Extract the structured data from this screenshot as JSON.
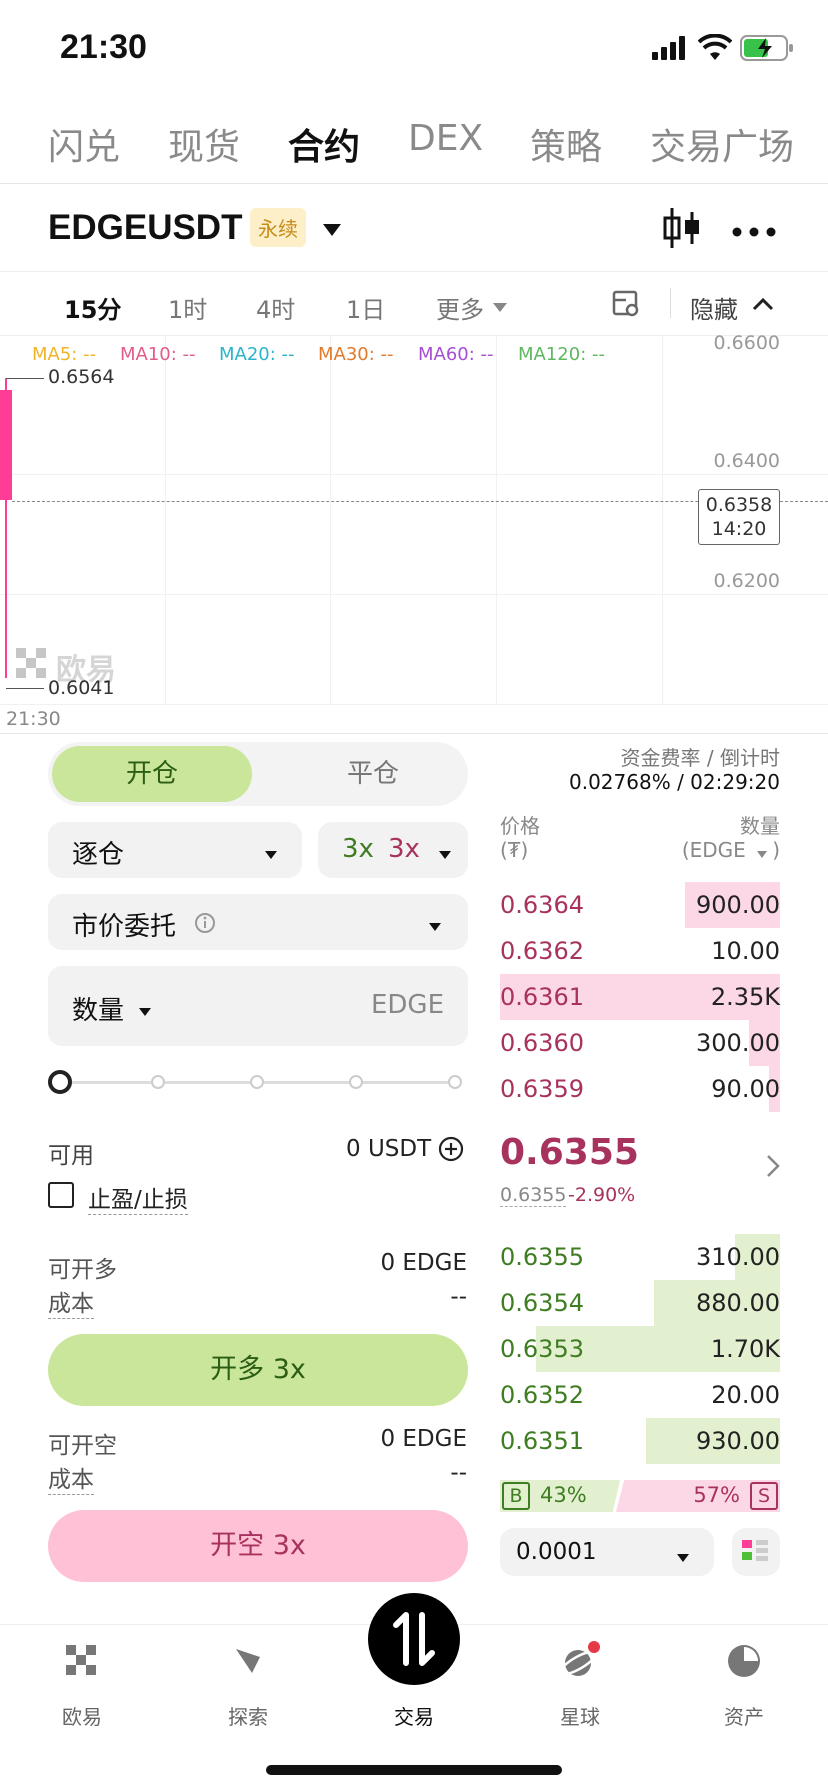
{
  "status": {
    "time": "21:30"
  },
  "top_nav": [
    "闪兑",
    "现货",
    "合约",
    "DEX",
    "策略",
    "交易广场"
  ],
  "top_nav_active": "合约",
  "pair": {
    "name": "EDGEUSDT",
    "badge": "永续"
  },
  "timeframes": [
    "15分",
    "1时",
    "4时",
    "1日",
    "更多"
  ],
  "timeframe_active": "15分",
  "chart_hide_label": "隐藏",
  "ma_labels": [
    "MA5: --",
    "MA10: --",
    "MA20: --",
    "MA30: --",
    "MA60: --",
    "MA120: --"
  ],
  "ma_colors": [
    "#f0b429",
    "#e05c8a",
    "#2bb5c9",
    "#e07a2b",
    "#a64fd3",
    "#5fb85f"
  ],
  "price_axis": [
    "0.6600",
    "0.6400",
    "0.6200"
  ],
  "chart": {
    "high_label": "0.6564",
    "low_label": "0.6041",
    "current_price": "0.6358",
    "countdown": "14:20",
    "time_label": "21:30",
    "watermark": "欧易"
  },
  "order": {
    "open_tab": "开仓",
    "close_tab": "平仓",
    "margin_mode": "逐仓",
    "leverage_long": "3x",
    "leverage_short": "3x",
    "order_type": "市价委托",
    "qty_label": "数量",
    "qty_unit": "EDGE",
    "available_label": "可用",
    "available_value": "0 USDT",
    "tpsl_label": "止盈/止损",
    "can_long_label": "可开多",
    "can_long_value": "0 EDGE",
    "cost_label": "成本",
    "cost_value": "--",
    "long_button": "开多 3x",
    "can_short_label": "可开空",
    "can_short_value": "0 EDGE",
    "cost2_label": "成本",
    "cost2_value": "--",
    "short_button": "开空 3x"
  },
  "funding": {
    "label": "资金费率 / 倒计时",
    "value": "0.02768% / 02:29:20"
  },
  "orderbook": {
    "price_header": "价格",
    "price_unit": "(₮)",
    "qty_header": "数量",
    "qty_unit": "(EDGE",
    "qty_unit_close": ")",
    "asks": [
      {
        "price": "0.6364",
        "qty": "900.00",
        "depth": 0.34
      },
      {
        "price": "0.6362",
        "qty": "10.00",
        "depth": 0.0
      },
      {
        "price": "0.6361",
        "qty": "2.35K",
        "depth": 1.0
      },
      {
        "price": "0.6360",
        "qty": "300.00",
        "depth": 0.11
      },
      {
        "price": "0.6359",
        "qty": "90.00",
        "depth": 0.04
      }
    ],
    "mid_price": "0.6355",
    "mark_price": "0.6355",
    "change": "-2.90%",
    "bids": [
      {
        "price": "0.6355",
        "qty": "310.00",
        "depth": 0.16
      },
      {
        "price": "0.6354",
        "qty": "880.00",
        "depth": 0.45
      },
      {
        "price": "0.6353",
        "qty": "1.70K",
        "depth": 0.87
      },
      {
        "price": "0.6352",
        "qty": "20.00",
        "depth": 0.0
      },
      {
        "price": "0.6351",
        "qty": "930.00",
        "depth": 0.48
      }
    ],
    "buy_label": "B",
    "buy_pct": "43%",
    "sell_pct": "57%",
    "sell_label": "S",
    "precision": "0.0001"
  },
  "bottom_nav": [
    "欧易",
    "探索",
    "交易",
    "星球",
    "资产"
  ],
  "bottom_nav_active": "交易",
  "colors": {
    "green": "#3f7d22",
    "green_bg": "#e3f0cf",
    "red": "#a8325e",
    "red_bg": "#fcd8e7",
    "long_btn": "#c9e69a",
    "short_btn": "#ffc1d5"
  }
}
